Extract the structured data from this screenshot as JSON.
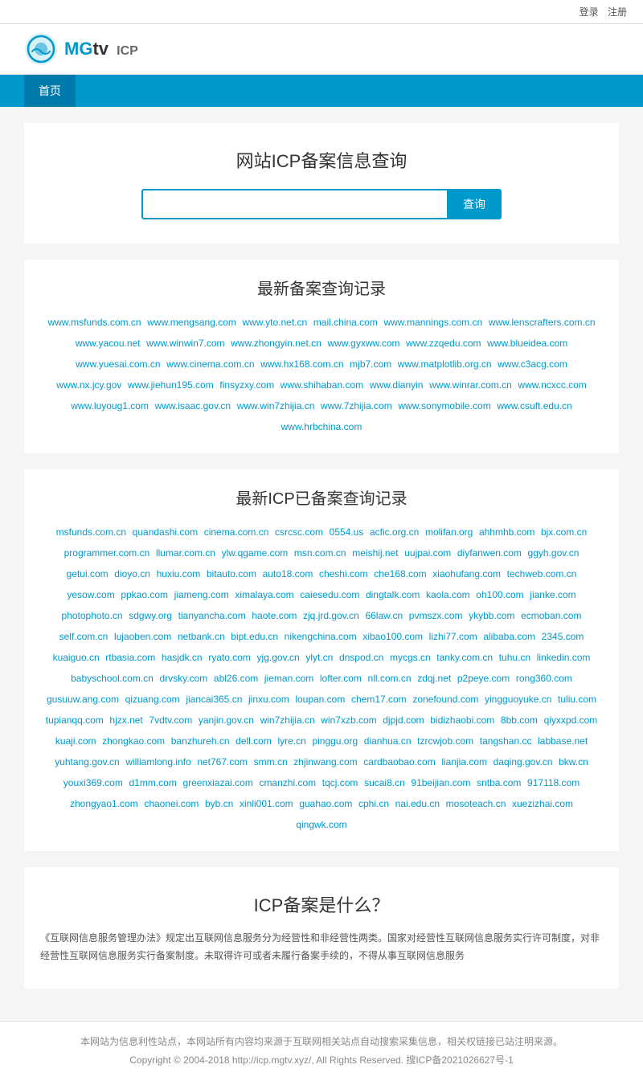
{
  "topbar": {
    "login": "登录",
    "register": "注册"
  },
  "header": {
    "logo_text_mg": "MG",
    "logo_text_tv": "tv",
    "logo_icp": "ICP"
  },
  "nav": {
    "items": [
      {
        "label": "首页",
        "active": true
      }
    ]
  },
  "search_section": {
    "title": "网站ICP备案信息查询",
    "input_placeholder": "",
    "button_label": "查询"
  },
  "recent_records": {
    "title": "最新备案查询记录",
    "links": [
      "www.msfunds.com.cn",
      "www.mengsang.com",
      "www.yto.net.cn",
      "mail.china.com",
      "www.mannings.com.cn",
      "www.lenscrafters.com.cn",
      "www.yacou.net",
      "www.winwin7.com",
      "www.zhongyin.net.cn",
      "www.gyxww.com",
      "www.zzqedu.com",
      "www.blueidea.com",
      "www.yuesai.com.cn",
      "www.cinema.com.cn",
      "www.hx168.com.cn",
      "mjb7.com",
      "www.matplotlib.org.cn",
      "www.c3acg.com",
      "www.nx.jcy.gov",
      "www.jiehun195.com",
      "finsyzxy.com",
      "www.shihaban.com",
      "www.dianyin",
      "www.winrar.com.cn",
      "www.ncxcc.com",
      "www.luyoug1.com",
      "www.isaac.gov.cn",
      "www.win7zhijia.cn",
      "www.7zhijia.com",
      "www.sonymobile.com",
      "www.csuft.edu.cn",
      "www.hrbchina.com"
    ]
  },
  "icp_records": {
    "title": "最新ICP已备案查询记录",
    "links": [
      "msfunds.com.cn",
      "quandashi.com",
      "cinema.com.cn",
      "csrcsc.com",
      "0554.us",
      "acfic.org.cn",
      "molifan.org",
      "ahhmhb.com",
      "bjx.com.cn",
      "programmer.com.cn",
      "llumar.com.cn",
      "ylw.qgame.com",
      "msn.com.cn",
      "meishij.net",
      "uujpai.com",
      "diyfanwen.com",
      "ggyh.gov.cn",
      "getui.com",
      "dioyo.cn",
      "huxiu.com",
      "bitauto.com",
      "auto18.com",
      "cheshi.com",
      "che168.com",
      "xiaohufang.com",
      "techweb.com.cn",
      "yesow.com",
      "ppkao.com",
      "jiameng.com",
      "ximalaya.com",
      "caiesedu.com",
      "dingtalk.com",
      "kaola.com",
      "oh100.com",
      "jianke.com",
      "photophoto.cn",
      "sdgwy.org",
      "tianyancha.com",
      "haote.com",
      "zjq.jrd.gov.cn",
      "66law.cn",
      "pvmszx.com",
      "ykybb.com",
      "ecmoban.com",
      "self.com.cn",
      "lujaoben.com",
      "netbank.cn",
      "bipt.edu.cn",
      "nikengchina.com",
      "xibao100.com",
      "lizhi77.com",
      "alibaba.com",
      "2345.com",
      "kuaiguo.cn",
      "rtbasia.com",
      "hasjdk.cn",
      "ryato.com",
      "yjg.gov.cn",
      "ylyt.cn",
      "dnspod.cn",
      "mycgs.cn",
      "tanky.com.cn",
      "tuhu.cn",
      "linkedin.com",
      "babyschool.com.cn",
      "drvsky.com",
      "abl26.com",
      "jieman.com",
      "lofter.com",
      "nll.com.cn",
      "zdqj.net",
      "p2peye.com",
      "rong360.com",
      "gusuuw.ang.com",
      "qizuang.com",
      "jiancai365.cn",
      "jinxu.com",
      "loupan.com",
      "chem17.com",
      "zonefound.com",
      "yingguoyuke.cn",
      "tuliu.com",
      "tupianqq.com",
      "hjzx.net",
      "7vdtv.com",
      "yanjin.gov.cn",
      "win7zhijia.cn",
      "win7xzb.com",
      "djpjd.com",
      "bidizhaobi.com",
      "8bb.com",
      "qiyxxpd.com",
      "kuaji.com",
      "zhongkao.com",
      "banzhureh.cn",
      "dell.com",
      "lyre.cn",
      "pinggu.org",
      "dianhua.cn",
      "tzrcwjob.com",
      "tangshan.cc",
      "labbase.net",
      "yuhtang.gov.cn",
      "williamlong.info",
      "net767.com",
      "smm.cn",
      "zhjinwang.com",
      "cardbaobao.com",
      "lianjia.com",
      "daqing.gov.cn",
      "bkw.cn",
      "youxi369.com",
      "d1mm.com",
      "greenxiazai.com",
      "cmanzhi.com",
      "tqcj.com",
      "sucai8.cn",
      "91beijian.com",
      "sntba.com",
      "917118.com",
      "zhongyao1.com",
      "chaonei.com",
      "byb.cn",
      "xinli001.com",
      "guahao.com",
      "cphi.cn",
      "nai.edu.cn",
      "mosoteach.cn",
      "xuezizhai.com",
      "qingwk.com"
    ]
  },
  "icp_info": {
    "title": "ICP备案是什么？",
    "content": "《互联网信息服务管理办法》规定出互联网信息服务分为经营性和非经营性两类。国家对经营性互联网信息服务实行许可制度，对非经营性互联网信息服务实行备案制度。未取得许可或者未履行备案手续的，不得从事互联网信息服务"
  },
  "footer": {
    "disclaimer": "本网站为信息利性站点，本网站所有内容均来源于互联网相关站点自动搜索采集信息，相关权链接已站注明来源。",
    "copyright": "Copyright © 2004-2018 http://icp.mgtv.xyz/, All Rights Reserved. 搜ICP备2021026627号-1"
  }
}
